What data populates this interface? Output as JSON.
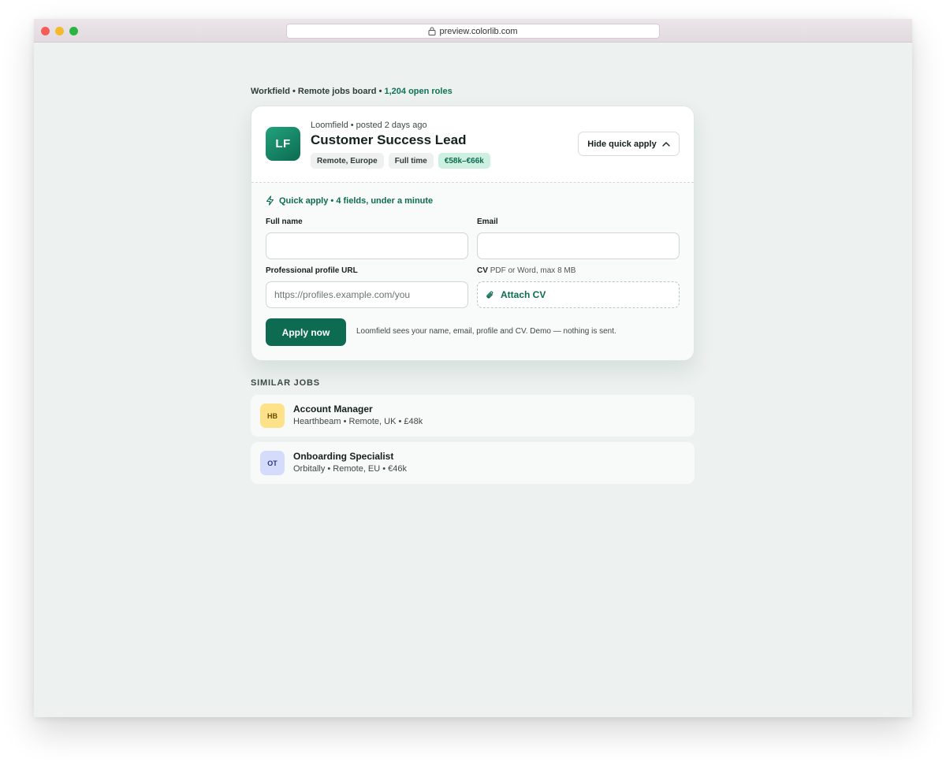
{
  "browser": {
    "url": "preview.colorlib.com"
  },
  "board": {
    "site": "Workfield",
    "separator": " • ",
    "description": "Remote jobs board",
    "open_roles": "1,204 open roles"
  },
  "job": {
    "logo_initials": "LF",
    "company": "Loomfield",
    "posted": "posted 2 days ago",
    "company_line": "Loomfield • posted 2 days ago",
    "title": "Customer Success Lead",
    "tags": [
      "Remote, Europe",
      "Full time"
    ],
    "salary": "€58k–€66k",
    "hide_button_label": "Hide quick apply"
  },
  "quick_apply": {
    "heading": "Quick apply • 4 fields, under a minute",
    "fields": {
      "full_name": {
        "label": "Full name",
        "value": ""
      },
      "email": {
        "label": "Email",
        "value": ""
      },
      "profile_url": {
        "label": "Professional profile URL",
        "placeholder": "https://profiles.example.com/you"
      },
      "cv": {
        "label": "CV",
        "hint": "PDF or Word, max 8 MB",
        "button_label": "Attach CV"
      }
    },
    "submit_label": "Apply now",
    "note": "Loomfield sees your name, email, profile and CV. Demo — nothing is sent."
  },
  "similar_jobs": {
    "heading": "SIMILAR JOBS",
    "items": [
      {
        "initials": "HB",
        "title": "Account Manager",
        "meta": "Hearthbeam • Remote, UK • £48k",
        "logo_bg": "#fde28a",
        "logo_fg": "#6b4e00"
      },
      {
        "initials": "OT",
        "title": "Onboarding Specialist",
        "meta": "Orbitally • Remote, EU • €46k",
        "logo_bg": "#d4dbfb",
        "logo_fg": "#2b3a80"
      }
    ]
  },
  "colors": {
    "accent": "#0d6b52",
    "page_bg": "#edf1f0",
    "salary_bg": "#cdf0e3"
  }
}
